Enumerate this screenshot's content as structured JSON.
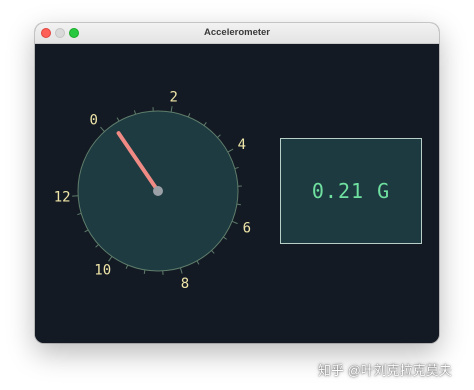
{
  "window": {
    "title": "Accelerometer"
  },
  "gauge": {
    "labels": [
      "0",
      "2",
      "4",
      "6",
      "8",
      "10",
      "12"
    ],
    "needle_value": 0.3,
    "colors": {
      "dial_fill": "#1d3b40",
      "dial_edge": "#5f7d6b",
      "label": "#f0e6a8",
      "needle": "#f08a84",
      "hub": "#9aa0a6"
    }
  },
  "readout": {
    "text": "0.21 G",
    "color": "#6fe0a0"
  },
  "watermark": {
    "text": "知乎 @叶刘克拉克莫夫"
  }
}
